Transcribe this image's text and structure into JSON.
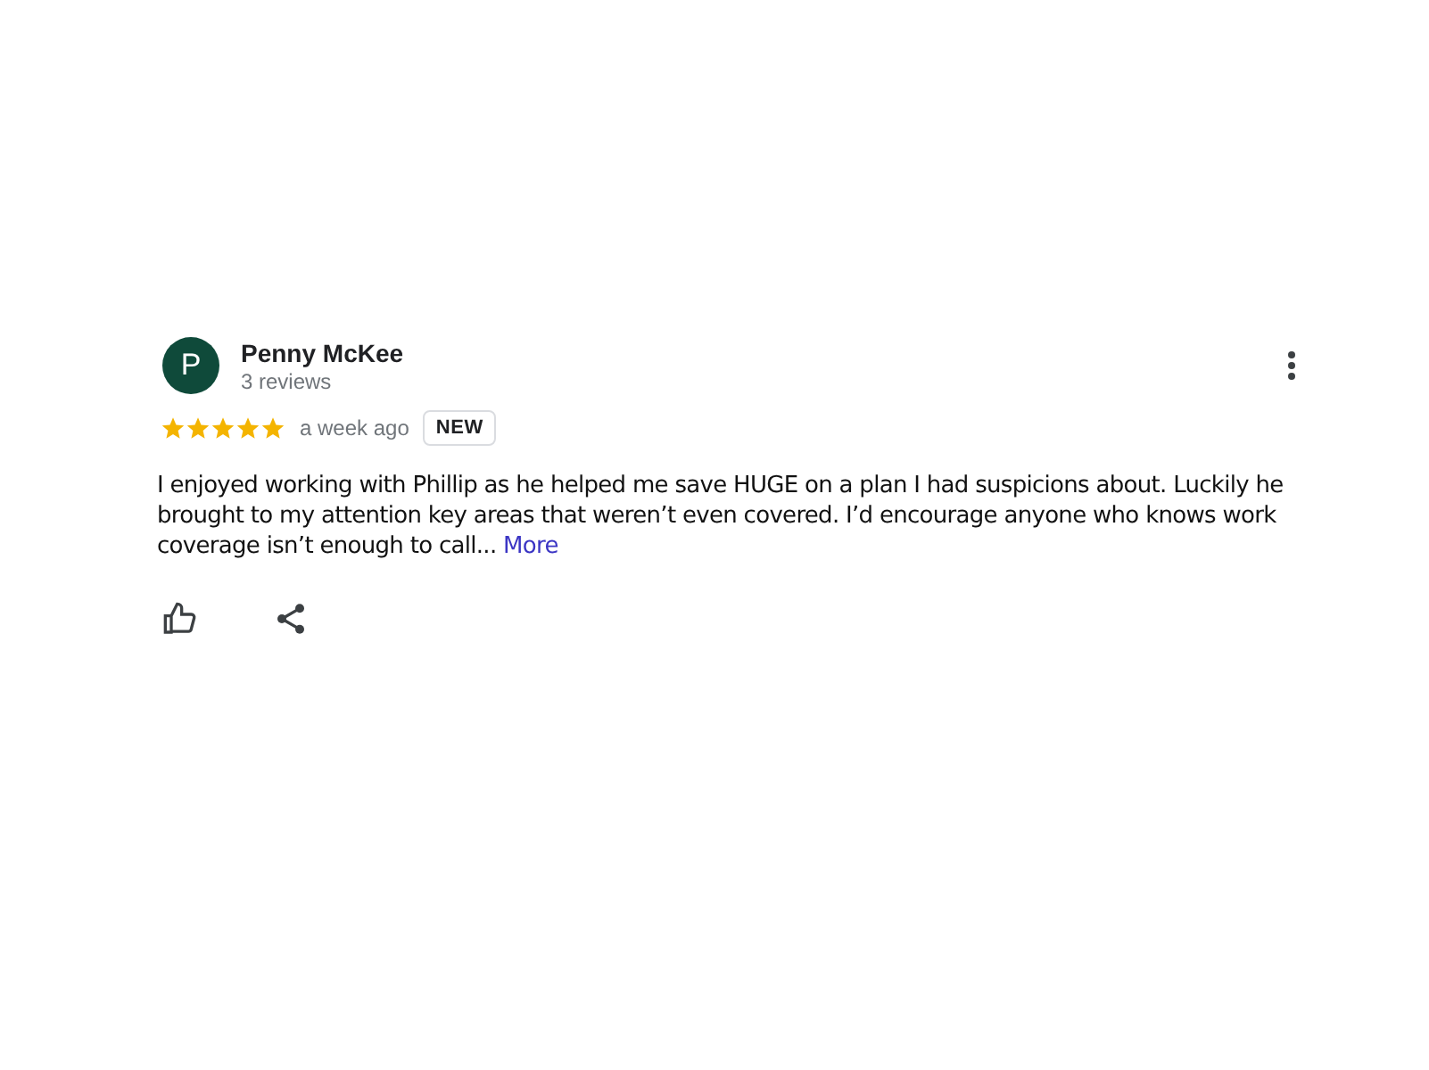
{
  "review": {
    "avatar_letter": "P",
    "author": "Penny McKee",
    "review_count": "3 reviews",
    "stars": 5,
    "time": "a week ago",
    "badge": "NEW",
    "text_lines": [
      "I enjoyed working with Phillip as he helped me save HUGE on a plan I had suspicions about.  Luckily he",
      "brought to my attention key areas that weren’t even covered. I’d encourage anyone who knows work",
      "coverage isn’t enough to call..."
    ],
    "more_link": "More"
  }
}
